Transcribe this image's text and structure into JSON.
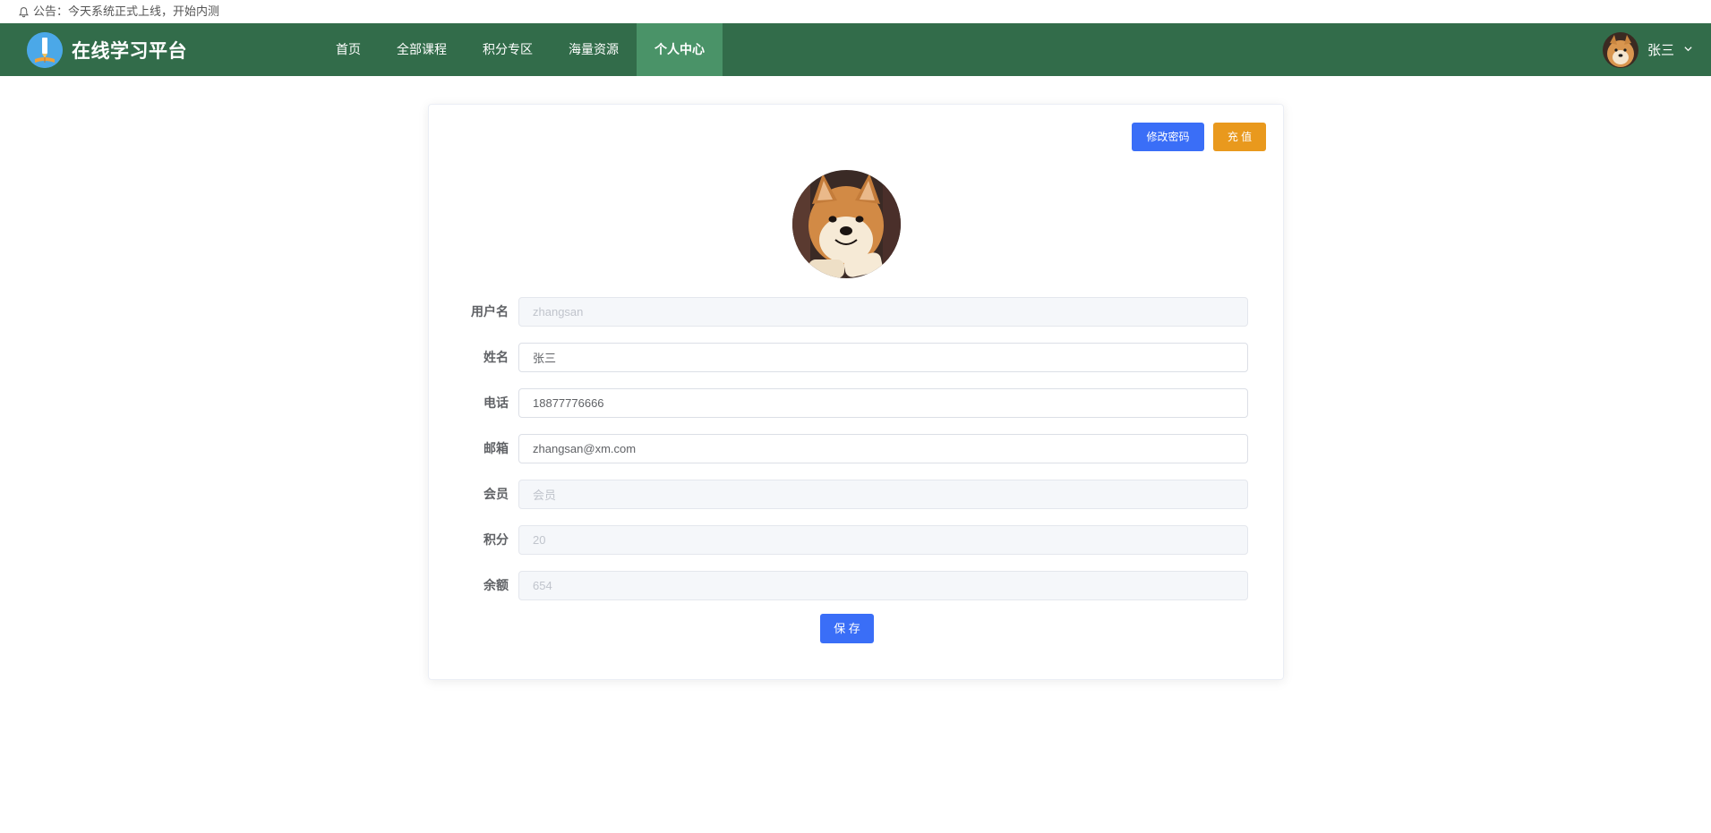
{
  "notice": {
    "text": "公告：今天系统正式上线，开始内测"
  },
  "header": {
    "title": "在线学习平台",
    "nav": [
      {
        "label": "首页"
      },
      {
        "label": "全部课程"
      },
      {
        "label": "积分专区"
      },
      {
        "label": "海量资源"
      },
      {
        "label": "个人中心"
      }
    ],
    "user_name": "张三"
  },
  "card": {
    "change_password_label": "修改密码",
    "recharge_label": "充 值",
    "save_label": "保 存"
  },
  "form": {
    "fields": [
      {
        "label": "用户名",
        "value": "zhangsan"
      },
      {
        "label": "姓名",
        "value": "张三"
      },
      {
        "label": "电话",
        "value": "18877776666"
      },
      {
        "label": "邮箱",
        "value": "zhangsan@xm.com"
      },
      {
        "label": "会员",
        "value": "会员"
      },
      {
        "label": "积分",
        "value": "20"
      },
      {
        "label": "余额",
        "value": "654"
      }
    ]
  },
  "colors": {
    "header_bg": "#326c4a",
    "nav_active_bg": "#4a9368",
    "primary": "#3a6ef7",
    "warning": "#e9991d"
  },
  "icons": {
    "notice": "bell-icon",
    "logo": "pen-book-logo-icon",
    "dropdown": "chevron-down-icon"
  }
}
